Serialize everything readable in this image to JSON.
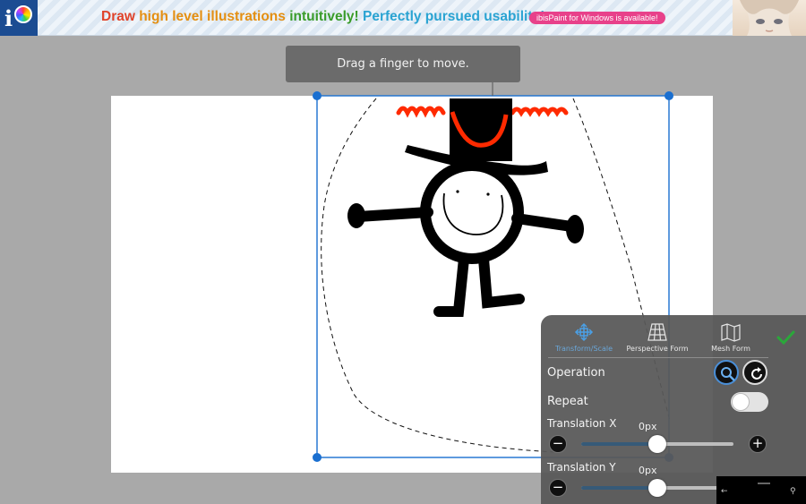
{
  "banner": {
    "words": [
      {
        "text": "Draw ",
        "color": "red"
      },
      {
        "text": "high level ",
        "color": "orange"
      },
      {
        "text": "illustrations ",
        "color": "orange"
      },
      {
        "text": "intuitively! ",
        "color": "green"
      },
      {
        "text": "Perfectly pursued usability!",
        "color": "blue"
      }
    ],
    "badge": "ibisPaint for Windows is available!"
  },
  "hint": "Drag a finger to move.",
  "panel": {
    "modes": [
      {
        "label": "Transform/Scale",
        "icon": "move-arrows-icon",
        "active": true
      },
      {
        "label": "Perspective Form",
        "icon": "perspective-grid-icon",
        "active": false
      },
      {
        "label": "Mesh Form",
        "icon": "mesh-map-icon",
        "active": false
      }
    ],
    "operation_label": "Operation",
    "repeat_label": "Repeat",
    "repeat_enabled": false,
    "translation_x": {
      "label": "Translation X",
      "value": "0px",
      "level": 0.5
    },
    "translation_y": {
      "label": "Translation Y",
      "value": "0px",
      "level": 0.5
    }
  },
  "colors": {
    "accent": "#1a6fd0",
    "panel_bg": "#585858",
    "confirm": "#2aa83a",
    "ink_red": "#ff2a00",
    "ink_black": "#000000"
  }
}
